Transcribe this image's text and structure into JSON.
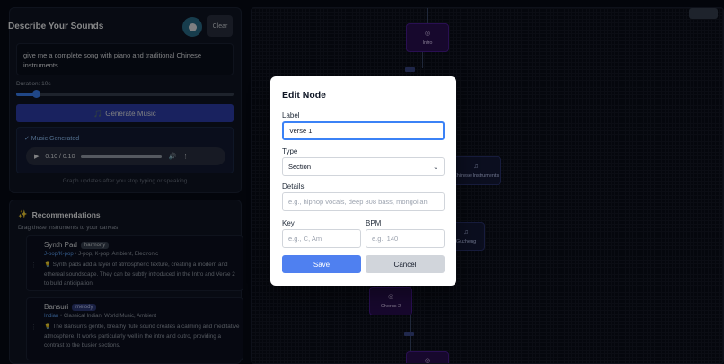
{
  "describe": {
    "title": "Describe Your Sounds",
    "clear_label": "Clear",
    "prompt_text": "give me a complete song with piano and traditional Chinese instruments",
    "duration_label": "Duration: 10s",
    "duration_fraction": 0.09,
    "generate_label": "Generate Music",
    "generated_label": "✓ Music Generated",
    "audio_time": "0:10 / 0:10",
    "graph_note": "Graph updates after you stop typing or speaking"
  },
  "recommendations": {
    "title": "Recommendations",
    "subtitle": "Drag these instruments to your canvas",
    "items": [
      {
        "name": "Synth Pad",
        "badge": "harmony",
        "main_genre": "J-pop/K-pop",
        "tags": "J-pop, K-pop, Ambient, Electronic",
        "description": "💡 Synth pads add a layer of atmospheric texture, creating a modern and ethereal soundscape. They can be subtly introduced in the Intro and Verse 2 to build anticipation."
      },
      {
        "name": "Bansuri",
        "badge": "melody",
        "main_genre": "Indian",
        "tags": "Classical Indian, World Music, Ambient",
        "description": "💡 The Bansuri's gentle, breathy flute sound creates a calming and meditative atmosphere. It works particularly well in the intro and outro, providing a contrast to the busier sections."
      }
    ]
  },
  "canvas": {
    "nodes": [
      {
        "label": "Intro"
      },
      {
        "label": "Chinese Instruments"
      },
      {
        "label": "Guzheng"
      },
      {
        "label": "Chorus 2"
      }
    ]
  },
  "modal": {
    "title": "Edit Node",
    "label_label": "Label",
    "label_value": "Verse 1",
    "type_label": "Type",
    "type_value": "Section",
    "details_label": "Details",
    "details_placeholder": "e.g., hiphop vocals, deep 808 bass, mongolian",
    "key_label": "Key",
    "key_placeholder": "e.g., C, Am",
    "bpm_label": "BPM",
    "bpm_placeholder": "e.g., 140",
    "save_label": "Save",
    "cancel_label": "Cancel"
  }
}
